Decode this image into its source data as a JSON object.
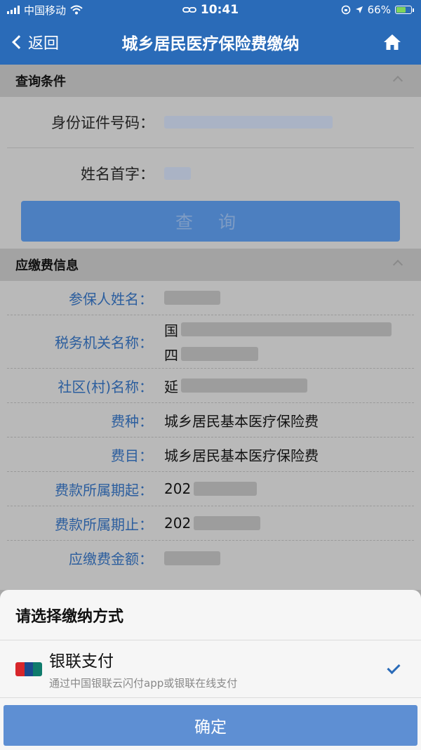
{
  "status_bar": {
    "carrier": "中国移动",
    "time": "10:41",
    "battery": "66%"
  },
  "navbar": {
    "back_label": "返回",
    "title": "城乡居民医疗保险费缴纳"
  },
  "query_section": {
    "header": "查询条件",
    "id_label": "身份证件号码：",
    "name_label": "姓名首字：",
    "button_label": "查 询"
  },
  "payment_info": {
    "header": "应缴费信息",
    "rows": [
      {
        "label": "参保人姓名：",
        "value": ""
      },
      {
        "label": "税务机关名称：",
        "value": "国",
        "value2": "四"
      },
      {
        "label": "社区(村)名称：",
        "value": "延"
      },
      {
        "label": "费种：",
        "value": "城乡居民基本医疗保险费"
      },
      {
        "label": "费目：",
        "value": "城乡居民基本医疗保险费"
      },
      {
        "label": "费款所属期起：",
        "value": "202"
      },
      {
        "label": "费款所属期止：",
        "value": "202"
      },
      {
        "label": "应缴费金额：",
        "value": ""
      }
    ]
  },
  "sheet": {
    "title": "请选择缴纳方式",
    "option_title": "银联支付",
    "option_desc": "通过中国银联云闪付app或银联在线支付",
    "confirm_label": "确定"
  },
  "colors": {
    "nav_bg": "#2a6bb8",
    "query_button": "#4c7fc0",
    "confirm_button": "#5e8fd3",
    "label_blue": "#2c5e9e"
  }
}
